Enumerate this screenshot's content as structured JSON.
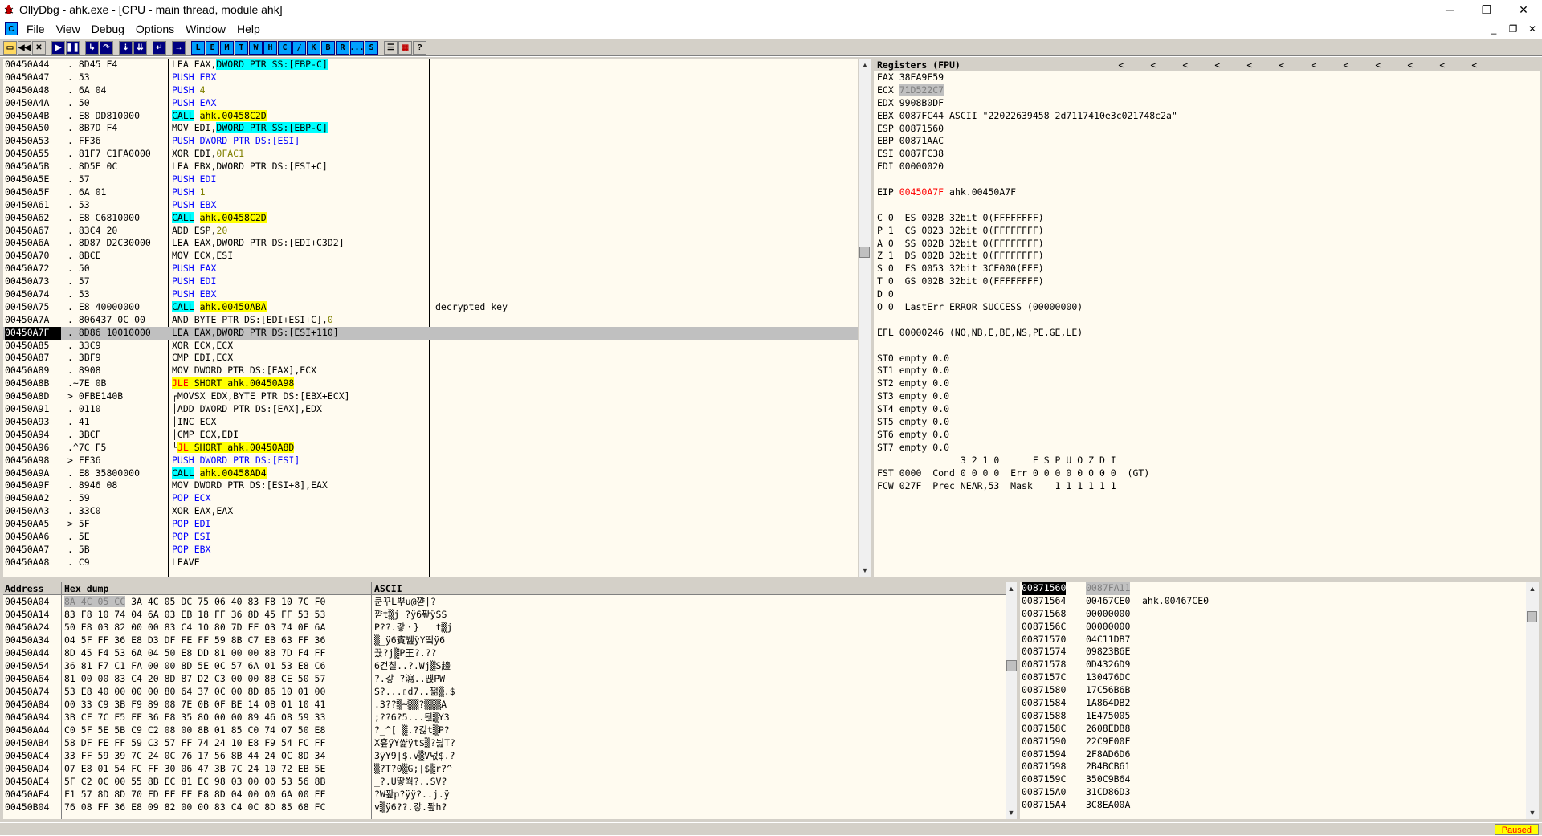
{
  "window": {
    "title": "OllyDbg - ahk.exe - [CPU - main thread, module ahk]",
    "minimize": "─",
    "maximize": "❐",
    "close": "✕"
  },
  "menu": [
    "File",
    "View",
    "Debug",
    "Options",
    "Window",
    "Help"
  ],
  "mdi_buttons": [
    "_",
    "❐",
    "✕"
  ],
  "toolbar": {
    "left": [
      "open",
      "rewind",
      "close",
      "run",
      "pause",
      "step-into",
      "step-over",
      "trace-into",
      "trace-over",
      "execute-till-return",
      "goto"
    ],
    "letters": [
      "L",
      "E",
      "M",
      "T",
      "W",
      "H",
      "C",
      "/",
      "K",
      "B",
      "R",
      "...",
      "S"
    ],
    "right": [
      "list",
      "grid",
      "?"
    ]
  },
  "disasm": [
    {
      "addr": "00450A44",
      "hex": ". 8D45 F4",
      "ins": [
        [
          "LEA EAX,",
          ""
        ],
        [
          "DWORD PTR SS:[EBP-C]",
          "mem"
        ]
      ]
    },
    {
      "addr": "00450A47",
      "hex": ". 53",
      "ins": [
        [
          "PUSH EBX",
          "push"
        ]
      ]
    },
    {
      "addr": "00450A48",
      "hex": ". 6A 04",
      "ins": [
        [
          "PUSH ",
          "push"
        ],
        [
          "4",
          "imm"
        ]
      ]
    },
    {
      "addr": "00450A4A",
      "hex": ". 50",
      "ins": [
        [
          "PUSH EAX",
          "push"
        ]
      ]
    },
    {
      "addr": "00450A4B",
      "hex": ". E8 DD810000",
      "ins": [
        [
          "CALL",
          "call"
        ],
        [
          " ",
          ""
        ],
        [
          "ahk.00458C2D",
          "tgt"
        ]
      ]
    },
    {
      "addr": "00450A50",
      "hex": ". 8B7D F4",
      "ins": [
        [
          "MOV EDI,",
          ""
        ],
        [
          "DWORD PTR SS:[EBP-C]",
          "mem"
        ]
      ]
    },
    {
      "addr": "00450A53",
      "hex": ". FF36",
      "ins": [
        [
          "PUSH DWORD PTR DS:[ESI]",
          "push"
        ]
      ]
    },
    {
      "addr": "00450A55",
      "hex": ". 81F7 C1FA0000",
      "ins": [
        [
          "XOR EDI,",
          ""
        ],
        [
          "0FAC1",
          "imm"
        ]
      ]
    },
    {
      "addr": "00450A5B",
      "hex": ". 8D5E 0C",
      "ins": [
        [
          "LEA EBX,DWORD PTR DS:[ESI+C]",
          ""
        ]
      ]
    },
    {
      "addr": "00450A5E",
      "hex": ". 57",
      "ins": [
        [
          "PUSH EDI",
          "push"
        ]
      ]
    },
    {
      "addr": "00450A5F",
      "hex": ". 6A 01",
      "ins": [
        [
          "PUSH ",
          "push"
        ],
        [
          "1",
          "imm"
        ]
      ]
    },
    {
      "addr": "00450A61",
      "hex": ". 53",
      "ins": [
        [
          "PUSH EBX",
          "push"
        ]
      ]
    },
    {
      "addr": "00450A62",
      "hex": ". E8 C6810000",
      "ins": [
        [
          "CALL",
          "call"
        ],
        [
          " ",
          ""
        ],
        [
          "ahk.00458C2D",
          "tgt"
        ]
      ]
    },
    {
      "addr": "00450A67",
      "hex": ". 83C4 20",
      "ins": [
        [
          "ADD ESP,",
          ""
        ],
        [
          "20",
          "imm"
        ]
      ]
    },
    {
      "addr": "00450A6A",
      "hex": ". 8D87 D2C30000",
      "ins": [
        [
          "LEA EAX,DWORD PTR DS:[EDI+C3D2]",
          ""
        ]
      ]
    },
    {
      "addr": "00450A70",
      "hex": ". 8BCE",
      "ins": [
        [
          "MOV ECX,ESI",
          ""
        ]
      ]
    },
    {
      "addr": "00450A72",
      "hex": ". 50",
      "ins": [
        [
          "PUSH EAX",
          "push"
        ]
      ]
    },
    {
      "addr": "00450A73",
      "hex": ". 57",
      "ins": [
        [
          "PUSH EDI",
          "push"
        ]
      ]
    },
    {
      "addr": "00450A74",
      "hex": ". 53",
      "ins": [
        [
          "PUSH EBX",
          "push"
        ]
      ]
    },
    {
      "addr": "00450A75",
      "hex": ". E8 40000000",
      "ins": [
        [
          "CALL",
          "call"
        ],
        [
          " ",
          ""
        ],
        [
          "ahk.00450ABA",
          "tgt"
        ]
      ],
      "cmt": "decrypted key"
    },
    {
      "addr": "00450A7A",
      "hex": ". 806437 0C 00",
      "ins": [
        [
          "AND BYTE PTR DS:[EDI+ESI+C],",
          ""
        ],
        [
          "0",
          "imm"
        ]
      ]
    },
    {
      "addr": "00450A7F",
      "hex": ". 8D86 10010000",
      "ins": [
        [
          "LEA EAX,DWORD PTR DS:[ESI+110]",
          ""
        ]
      ],
      "cur": true
    },
    {
      "addr": "00450A85",
      "hex": ". 33C9",
      "ins": [
        [
          "XOR ECX,ECX",
          ""
        ]
      ]
    },
    {
      "addr": "00450A87",
      "hex": ". 3BF9",
      "ins": [
        [
          "CMP EDI,ECX",
          ""
        ]
      ]
    },
    {
      "addr": "00450A89",
      "hex": ". 8908",
      "ins": [
        [
          "MOV DWORD PTR DS:[EAX],ECX",
          ""
        ]
      ]
    },
    {
      "addr": "00450A8B",
      "hex": ".~7E 0B",
      "ins": [
        [
          "JLE",
          "jmp"
        ],
        [
          " SHORT ahk.00450A98",
          "tgt"
        ]
      ]
    },
    {
      "addr": "00450A8D",
      "hex": "> 0FBE140B",
      "ins": [
        [
          "┌MOVSX EDX,BYTE PTR DS:[EBX+ECX]",
          ""
        ]
      ]
    },
    {
      "addr": "00450A91",
      "hex": ". 0110",
      "ins": [
        [
          "│ADD DWORD PTR DS:[EAX],EDX",
          ""
        ]
      ]
    },
    {
      "addr": "00450A93",
      "hex": ". 41",
      "ins": [
        [
          "│INC ECX",
          ""
        ]
      ]
    },
    {
      "addr": "00450A94",
      "hex": ". 3BCF",
      "ins": [
        [
          "│CMP ECX,EDI",
          ""
        ]
      ]
    },
    {
      "addr": "00450A96",
      "hex": ".^7C F5",
      "ins": [
        [
          "└",
          ""
        ],
        [
          "JL",
          "jmp"
        ],
        [
          " SHORT ahk.00450A8D",
          "tgt"
        ]
      ]
    },
    {
      "addr": "00450A98",
      "hex": "> FF36",
      "ins": [
        [
          "PUSH DWORD PTR DS:[ESI]",
          "push"
        ]
      ]
    },
    {
      "addr": "00450A9A",
      "hex": ". E8 35800000",
      "ins": [
        [
          "CALL",
          "call"
        ],
        [
          " ",
          ""
        ],
        [
          "ahk.00458AD4",
          "tgt"
        ]
      ]
    },
    {
      "addr": "00450A9F",
      "hex": ". 8946 08",
      "ins": [
        [
          "MOV DWORD PTR DS:[ESI+8],EAX",
          ""
        ]
      ]
    },
    {
      "addr": "00450AA2",
      "hex": ". 59",
      "ins": [
        [
          "POP ECX",
          "push"
        ]
      ]
    },
    {
      "addr": "00450AA3",
      "hex": ". 33C0",
      "ins": [
        [
          "XOR EAX,EAX",
          ""
        ]
      ]
    },
    {
      "addr": "00450AA5",
      "hex": "> 5F",
      "ins": [
        [
          "POP EDI",
          "push"
        ]
      ]
    },
    {
      "addr": "00450AA6",
      "hex": ". 5E",
      "ins": [
        [
          "POP ESI",
          "push"
        ]
      ]
    },
    {
      "addr": "00450AA7",
      "hex": ". 5B",
      "ins": [
        [
          "POP EBX",
          "push"
        ]
      ]
    },
    {
      "addr": "00450AA8",
      "hex": ". C9",
      "ins": [
        [
          "LEAVE",
          ""
        ]
      ]
    }
  ],
  "registers": {
    "header": "Registers (FPU)",
    "header_arrows": [
      "<",
      "<",
      "<",
      "<",
      "<",
      "<",
      "<",
      "<",
      "<",
      "<",
      "<",
      "<"
    ],
    "lines": [
      [
        [
          "EAX 38EA9F59",
          ""
        ]
      ],
      [
        [
          "ECX ",
          ""
        ],
        [
          "71D522C7",
          "sel"
        ]
      ],
      [
        [
          "EDX 9908B0DF",
          ""
        ]
      ],
      [
        [
          "EBX 0087FC44 ASCII \"22022639458 2d7117410e3c021748c2a\"",
          ""
        ]
      ],
      [
        [
          "ESP 00871560",
          ""
        ]
      ],
      [
        [
          "EBP 00871AAC",
          ""
        ]
      ],
      [
        [
          "ESI 0087FC38",
          ""
        ]
      ],
      [
        [
          "EDI 00000020",
          ""
        ]
      ],
      [
        [
          "",
          ""
        ]
      ],
      [
        [
          "EIP ",
          ""
        ],
        [
          "00450A7F",
          "red"
        ],
        [
          " ahk.00450A7F",
          ""
        ]
      ],
      [
        [
          "",
          ""
        ]
      ],
      [
        [
          "C 0  ES 002B 32bit 0(FFFFFFFF)",
          ""
        ]
      ],
      [
        [
          "P 1  CS 0023 32bit 0(FFFFFFFF)",
          ""
        ]
      ],
      [
        [
          "A 0  SS 002B 32bit 0(FFFFFFFF)",
          ""
        ]
      ],
      [
        [
          "Z 1  DS 002B 32bit 0(FFFFFFFF)",
          ""
        ]
      ],
      [
        [
          "S 0  FS 0053 32bit 3CE000(FFF)",
          ""
        ]
      ],
      [
        [
          "T 0  GS 002B 32bit 0(FFFFFFFF)",
          ""
        ]
      ],
      [
        [
          "D 0",
          ""
        ]
      ],
      [
        [
          "O 0  LastErr ERROR_SUCCESS (00000000)",
          ""
        ]
      ],
      [
        [
          "",
          ""
        ]
      ],
      [
        [
          "EFL 00000246 (NO,NB,E,BE,NS,PE,GE,LE)",
          ""
        ]
      ],
      [
        [
          "",
          ""
        ]
      ],
      [
        [
          "ST0 empty 0.0",
          ""
        ]
      ],
      [
        [
          "ST1 empty 0.0",
          ""
        ]
      ],
      [
        [
          "ST2 empty 0.0",
          ""
        ]
      ],
      [
        [
          "ST3 empty 0.0",
          ""
        ]
      ],
      [
        [
          "ST4 empty 0.0",
          ""
        ]
      ],
      [
        [
          "ST5 empty 0.0",
          ""
        ]
      ],
      [
        [
          "ST6 empty 0.0",
          ""
        ]
      ],
      [
        [
          "ST7 empty 0.0",
          ""
        ]
      ],
      [
        [
          "               3 2 1 0      E S P U O Z D I",
          ""
        ]
      ],
      [
        [
          "FST 0000  Cond 0 0 0 0  Err 0 0 0 0 0 0 0 0  (GT)",
          ""
        ]
      ],
      [
        [
          "FCW 027F  Prec NEAR,53  Mask    1 1 1 1 1 1",
          ""
        ]
      ]
    ]
  },
  "dump": {
    "headers": {
      "address": "Address",
      "hex": "Hex dump",
      "ascii": "ASCII"
    },
    "rows": [
      {
        "addr": "00450A04",
        "hex": "8A 4C 05 CC 3A 4C 05 DC 75 06 40 83 F8 10 7C F0",
        "ascii": "쿤꾸L뿌u@꺋|?"
      },
      {
        "addr": "00450A14",
        "hex": "83 F8 10 74 04 6A 03 EB 18 FF 36 8D 45 FF 53 53",
        "ascii": "꺋t▒j ?ÿ6퐢ÿSS"
      },
      {
        "addr": "00450A24",
        "hex": "50 E8 03 82 00 00 83 C4 10 80 7D FF 03 74 0F 6A",
        "ascii": "P??.갛ㆍ}   t▒j"
      },
      {
        "addr": "00450A34",
        "hex": "04 5F FF 36 E8 D3 DF FE FF 59 8B C7 EB 63 FF 36",
        "ascii": "▒_ÿ6賓뷆ÿY떸ÿ6"
      },
      {
        "addr": "00450A44",
        "hex": "8D 45 F4 53 6A 04 50 E8 DD 81 00 00 8B 7D F4 FF",
        "ascii": "뀼?j▒P王?.??"
      },
      {
        "addr": "00450A54",
        "hex": "36 81 F7 C1 FA 00 00 8D 5E 0C 57 6A 01 53 E8 C6",
        "ascii": "6걷칠..?.Wj▒S䟍"
      },
      {
        "addr": "00450A64",
        "hex": "81 00 00 83 C4 20 8D 87 D2 C3 00 00 8B CE 50 57",
        "ascii": "?.갛 ?瀉..뗹PW"
      },
      {
        "addr": "00450A74",
        "hex": "53 E8 40 00 00 00 80 64 37 0C 00 8D 86 10 01 00",
        "ascii": "S?...▯d7..쩖▒.$"
      },
      {
        "addr": "00450A84",
        "hex": "00 33 C9 3B F9 89 08 7E 0B 0F BE 14 0B 01 10 41",
        "ascii": ".3??▒~▒▒?▒▒▒A"
      },
      {
        "addr": "00450A94",
        "hex": "3B CF 7C F5 FF 36 E8 35 80 00 00 89 46 08 59 33",
        "ascii": ";??6?5...됝▒Y3"
      },
      {
        "addr": "00450AA4",
        "hex": "C0 5F 5E 5B C9 C2 08 00 8B 01 85 C0 74 07 50 E8",
        "ascii": "?_^[ ▒.?긿t▒P?"
      },
      {
        "addr": "00450AB4",
        "hex": "58 DF FE FF 59 C3 57 FF 74 24 10 E8 F9 54 FC FF",
        "ascii": "X훞ÿY쌽ÿt$▒?뇚T?"
      },
      {
        "addr": "00450AC4",
        "hex": "33 FF 59 39 7C 24 0C 76 17 56 8B 44 24 0C 8D 34",
        "ascii": "3ÿY9|$.v▒V덗$.?"
      },
      {
        "addr": "00450AD4",
        "hex": "07 E8 01 54 FC FF 30 06 47 3B 7C 24 10 72 EB 5E",
        "ascii": "▒?T?0▒G;|$▒r?^"
      },
      {
        "addr": "00450AE4",
        "hex": "5F C2 0C 00 55 8B EC 81 EC 98 03 00 00 53 56 8B",
        "ascii": "_?.U땋쒁?..SV?"
      },
      {
        "addr": "00450AF4",
        "hex": "F1 57 8D 8D 70 FD FF FF E8 8D 04 00 00 6A 00 FF",
        "ascii": "?W퐢p?ÿÿ?..j.ÿ"
      },
      {
        "addr": "00450B04",
        "hex": "76 08 FF 36 E8 09 82 00 00 83 C4 0C 8D 85 68 FC",
        "ascii": "v▒ÿ6??.갛.퐢h?"
      }
    ]
  },
  "stack": [
    {
      "a": "00871560",
      "v": "0087FA11",
      "c": ""
    },
    {
      "a": "00871564",
      "v": "00467CE0",
      "c": "ahk.00467CE0"
    },
    {
      "a": "00871568",
      "v": "00000000",
      "c": ""
    },
    {
      "a": "0087156C",
      "v": "00000000",
      "c": ""
    },
    {
      "a": "00871570",
      "v": "04C11DB7",
      "c": ""
    },
    {
      "a": "00871574",
      "v": "09823B6E",
      "c": ""
    },
    {
      "a": "00871578",
      "v": "0D4326D9",
      "c": ""
    },
    {
      "a": "0087157C",
      "v": "130476DC",
      "c": ""
    },
    {
      "a": "00871580",
      "v": "17C56B6B",
      "c": ""
    },
    {
      "a": "00871584",
      "v": "1A864DB2",
      "c": ""
    },
    {
      "a": "00871588",
      "v": "1E475005",
      "c": ""
    },
    {
      "a": "0087158C",
      "v": "2608EDB8",
      "c": ""
    },
    {
      "a": "00871590",
      "v": "22C9F00F",
      "c": ""
    },
    {
      "a": "00871594",
      "v": "2F8AD6D6",
      "c": ""
    },
    {
      "a": "00871598",
      "v": "2B4BCB61",
      "c": ""
    },
    {
      "a": "0087159C",
      "v": "350C9B64",
      "c": ""
    },
    {
      "a": "008715A0",
      "v": "31CD86D3",
      "c": ""
    },
    {
      "a": "008715A4",
      "v": "3C8EA00A",
      "c": ""
    }
  ],
  "status": {
    "state": "Paused"
  }
}
